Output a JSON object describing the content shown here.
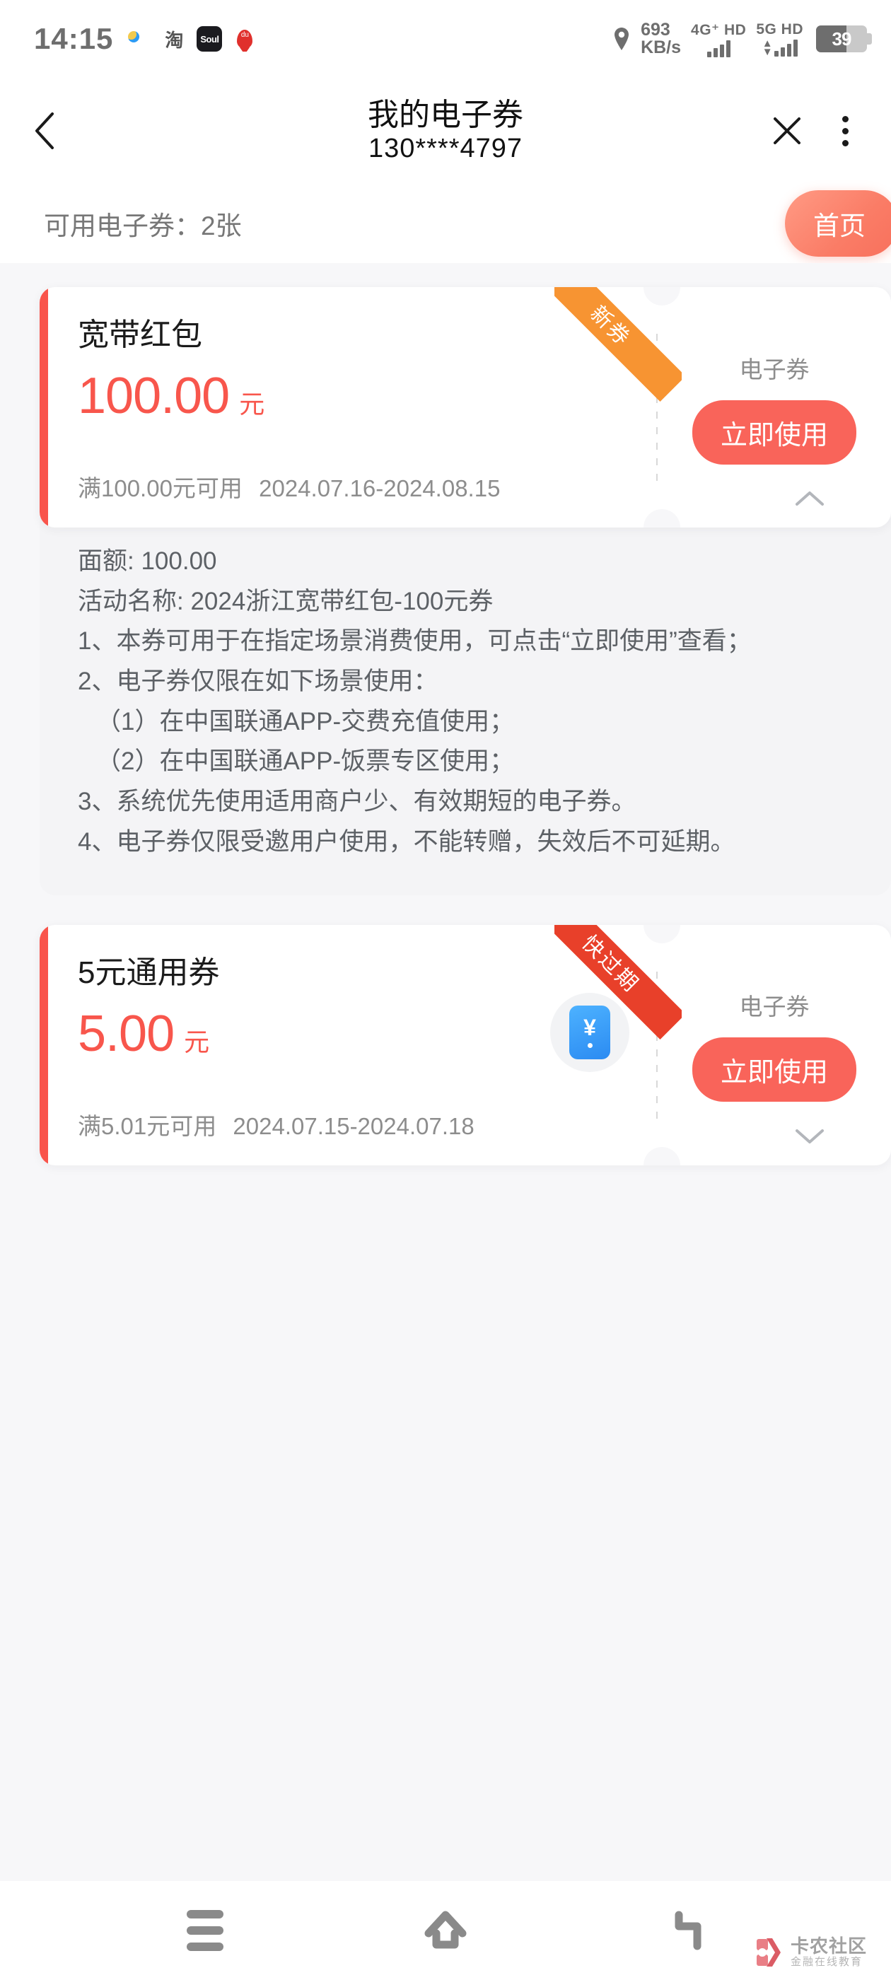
{
  "status_bar": {
    "time": "14:15",
    "tray_icons": [
      "video-app-icon",
      "taobao-icon",
      "soul-icon",
      "baidu-map-icon"
    ],
    "tao_glyph": "淘",
    "soul_glyph": "Soul",
    "map_glyph": "du",
    "net_speed_value": "693",
    "net_speed_unit": "KB/s",
    "sim1_label": "4G⁺ HD",
    "sim2_label": "5G HD",
    "battery_level": "39"
  },
  "header": {
    "title": "我的电子券",
    "subtitle": "130****4797",
    "back_icon": "chevron-left-icon",
    "close_icon": "close-icon",
    "more_icon": "more-vertical-icon"
  },
  "sub_header": {
    "available_text": "可用电子券：2张",
    "home_button": "首页"
  },
  "coupons": [
    {
      "title": "宽带红包",
      "amount": "100.00",
      "unit": "元",
      "threshold": "满100.00元可用",
      "validity": "2024.07.16-2024.08.15",
      "type_label": "电子券",
      "use_button": "立即使用",
      "ribbon": "新券",
      "ribbon_style": "new",
      "ribbon_color": "#f79432",
      "expanded": true,
      "toggle_icon": "chevron-up-icon",
      "has_brand_badge": false,
      "details": [
        {
          "text": "面额: 100.00",
          "indent": false
        },
        {
          "text": "活动名称: 2024浙江宽带红包-100元券",
          "indent": false
        },
        {
          "text": "1、本券可用于在指定场景消费使用，可点击“立即使用”查看；",
          "indent": false
        },
        {
          "text": "2、电子券仅限在如下场景使用：",
          "indent": false
        },
        {
          "text": "（1）在中国联通APP-交费充值使用；",
          "indent": true
        },
        {
          "text": "（2）在中国联通APP-饭票专区使用；",
          "indent": true
        },
        {
          "text": "3、系统优先使用适用商户少、有效期短的电子券。",
          "indent": false
        },
        {
          "text": "4、电子券仅限受邀用户使用，不能转赠，失效后不可延期。",
          "indent": false
        }
      ]
    },
    {
      "title": "5元通用券",
      "amount": "5.00",
      "unit": "元",
      "threshold": "满5.01元可用",
      "validity": "2024.07.15-2024.07.18",
      "type_label": "电子券",
      "use_button": "立即使用",
      "ribbon": "快过期",
      "ribbon_style": "expiring",
      "ribbon_color": "#e8402a",
      "expanded": false,
      "toggle_icon": "chevron-down-icon",
      "has_brand_badge": true,
      "badge_glyph": "¥",
      "details": []
    }
  ],
  "bottom_nav": {
    "recents_icon": "menu-bars-icon",
    "home_icon": "home-icon",
    "back_icon": "back-arrow-icon"
  },
  "watermark": {
    "name": "卡农社区",
    "tagline": "金融在线教育"
  },
  "colors": {
    "accent_red": "#f9544b",
    "use_button": "#f9645a",
    "ribbon_new": "#f79432",
    "ribbon_expiring": "#e8402a",
    "page_bg": "#f7f7f9",
    "detail_bg": "#f4f4f6"
  }
}
